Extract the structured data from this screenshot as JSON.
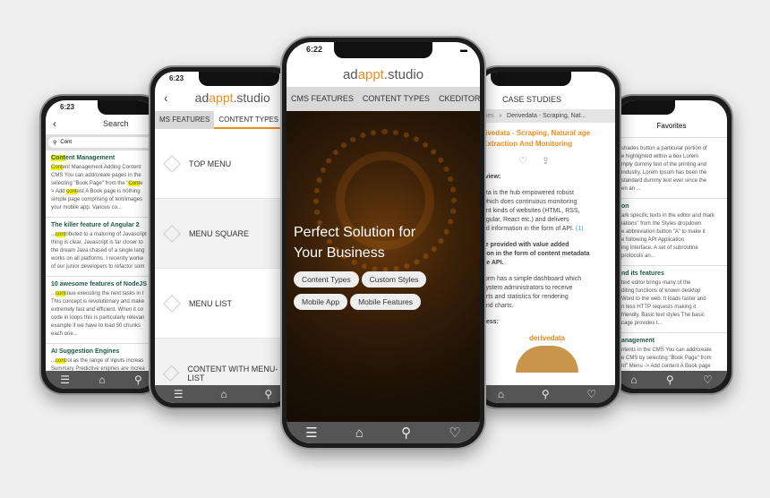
{
  "search_phone": {
    "time": "6:23",
    "title": "Search",
    "query": "Cont",
    "results": [
      {
        "title": "Content Management",
        "lines": [
          "Content Management Adding Content",
          "CMS You can add/create pages in the",
          "selecting \"Book Page\" from the \"Conte",
          "> Add content A Book page is nothing",
          "simple page comprising of text/images",
          "your mobile app. Various co..."
        ]
      },
      {
        "title": "The killer feature of Angular 2",
        "lines": [
          "...contributed to a maturing of Javascript",
          "thing is clear, Javascript is far closer to",
          "the dream Java chased of a single lang",
          "works on all platforms. I recently worke",
          "of our junior developers to refactor som"
        ]
      },
      {
        "title": "10 awesome features of NodeJS",
        "lines": [
          "...continue executing the next tasks in t",
          "This concept is revolutionary and make",
          "extremely fast and efficient. When it co",
          "code in loops this is particularly relevan",
          "example if we have to load 50 chunks",
          "each one..."
        ]
      },
      {
        "title": "AI Suggestion Engines",
        "lines": [
          "...control as the range of inputs increas",
          "Summary Predictive engines are increa",
          "giving the giants like Netflix and Amaz"
        ]
      }
    ]
  },
  "menu_phone": {
    "time": "6:23",
    "logo": {
      "a": "ad",
      "b": "appt",
      "c": ".studio"
    },
    "tabs": [
      "MS FEATURES",
      "CONTENT TYPES",
      "CK"
    ],
    "items": [
      "TOP MENU",
      "MENU SQUARE",
      "MENU LIST",
      "CONTENT WITH MENU-LIST"
    ]
  },
  "main_phone": {
    "time": "6:22",
    "logo": {
      "a": "ad",
      "b": "appt",
      "c": ".studio"
    },
    "tabs": [
      "CMS FEATURES",
      "CONTENT TYPES",
      "CKEDITOR"
    ],
    "hero_title": "Perfect Solution for Your Business",
    "chips": [
      "Content Types",
      "Custom Styles",
      "Mobile App",
      "Mobile Features"
    ]
  },
  "case_phone": {
    "title": "CASE STUDIES",
    "breadcrumb": [
      "udies",
      "Derivedata - Scraping, Nat..."
    ],
    "heading": "rivedata - Scraping, Natural age Extraction And Monitoring",
    "overview": "rview:",
    "para1": [
      "ata is the hub empowered robust",
      "which does continuous monitoring",
      "ent kinds of websites (HTML, RSS,",
      "ngular, React etc.) and delivers",
      "ed information in the form of API."
    ],
    "ref": "(1)",
    "para2": [
      "re provided with value added",
      "tion in the form of content metadata",
      "he API."
    ],
    "para3": [
      "form has a simple dashboard which",
      "system administrators to receive",
      "erts and statistics for rendering",
      "and charts."
    ],
    "process": "cess:",
    "figure_logo": "derivedata"
  },
  "fav_phone": {
    "title": "Favorites",
    "items": [
      {
        "title": "",
        "lines": [
          "shades button a particular portion of",
          "e highlighted within a box Lorem",
          "mply dummy text of the printing and",
          "industry. Lorem Ipsum has been the",
          "standard dummy text ever since the",
          "en an ..."
        ]
      },
      {
        "title": "on",
        "lines": [
          "ark specific texts in the editor and mark",
          "iations\" from the Styles dropdown",
          "e abbreviation button \"A\" to make it",
          "e following API Application",
          "ing Interface. A set of subroutine",
          "protocols an..."
        ]
      },
      {
        "title": "nd its features",
        "lines": [
          "text editor brings many of the",
          "diting functions of known desktop",
          "Word to the web. It loads faster and",
          "n less HTTP requests making it",
          "friendly. Basic text styles The basic",
          "cage provides t..."
        ]
      },
      {
        "title": "anagement",
        "lines": [
          "ntents in the CMS You can add/create",
          "e CMS by selecting \"Book Page\" from",
          "nt\" Menu -> Add content A Book page",
          "out a simple page comprising of text/",
          "les in your mobile app. Various content"
        ]
      }
    ]
  },
  "colors": {
    "accent": "#f08c1e",
    "heading_green": "#1e5a4a",
    "nav": "#555555",
    "highlight": "#f3f300"
  }
}
